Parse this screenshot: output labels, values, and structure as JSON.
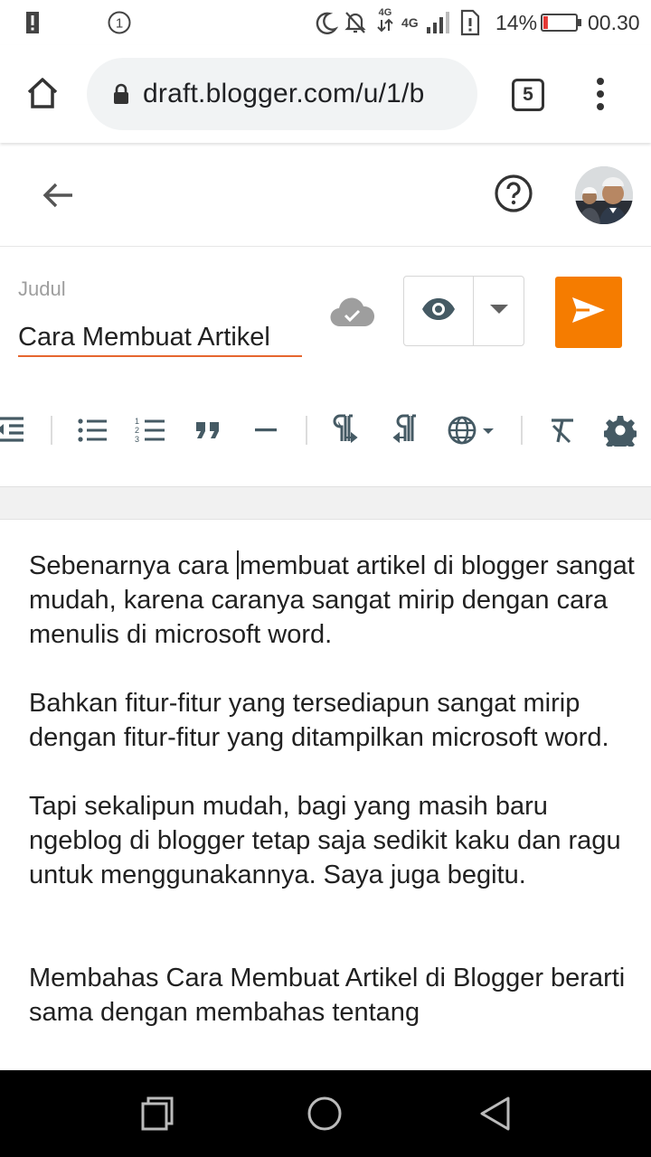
{
  "status_bar": {
    "notification_count": "1",
    "network_label": "4G",
    "battery_percent": "14%",
    "battery_level": 0.14,
    "time": "00.30"
  },
  "browser": {
    "url": "draft.blogger.com/u/1/b",
    "tab_count": "5"
  },
  "post": {
    "title_label": "Judul",
    "title_value": "Cara Membuat Artikel"
  },
  "editor": {
    "paragraphs": [
      {
        "before_cursor": "Sebenarnya cara ",
        "after_cursor": "membuat artikel di blogger sangat mudah, karena caranya sangat mirip dengan cara menulis di microsoft word."
      },
      {
        "text": "Bahkan fitur-fitur yang tersediapun sangat mirip dengan fitur-fitur yang ditampilkan microsoft word."
      },
      {
        "text": "Tapi sekalipun mudah, bagi yang masih baru ngeblog di blogger tetap saja sedikit kaku dan ragu untuk menggunakannya. Saya juga begitu."
      },
      {
        "text": "Membahas Cara Membuat Artikel di Blogger berarti sama dengan membahas tentang"
      }
    ]
  },
  "colors": {
    "publish": "#f57c00",
    "title_underline": "#e6662f",
    "icon": "#455a64"
  },
  "icons": [
    "alert-icon",
    "notification-count-icon",
    "moon-icon",
    "bell-off-icon",
    "data-arrows-icon",
    "signal-icon",
    "sim-alert-icon",
    "battery-icon",
    "home-icon",
    "lock-icon",
    "tab-switcher-icon",
    "more-vert-icon",
    "back-arrow-icon",
    "help-icon",
    "avatar",
    "cloud-saved-icon",
    "eye-icon",
    "caret-down-icon",
    "send-icon",
    "outdent-icon",
    "bulleted-list-icon",
    "numbered-list-icon",
    "quote-icon",
    "horizontal-line-icon",
    "ltr-icon",
    "rtl-icon",
    "language-icon",
    "clear-format-icon",
    "settings-icon",
    "recents-icon",
    "home-circle-icon",
    "back-triangle-icon"
  ]
}
